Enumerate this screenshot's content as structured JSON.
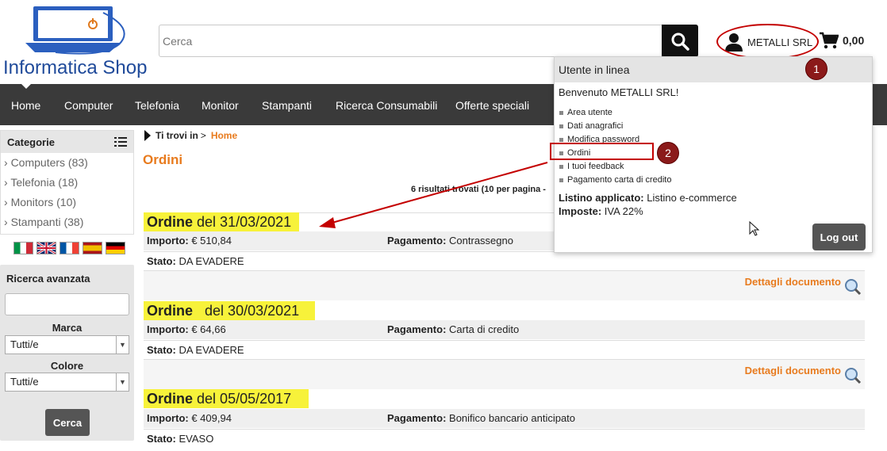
{
  "header": {
    "brand": "Informatica Shop",
    "search_placeholder": "Cerca",
    "user_name": "METALLI SRL",
    "cart_total": "0,00"
  },
  "nav": {
    "items": [
      "Home",
      "Computer",
      "Telefonia",
      "Monitor",
      "Stampanti",
      "Ricerca Consumabili",
      "Offerte speciali"
    ]
  },
  "sidebar": {
    "categories_title": "Categorie",
    "categories": [
      "Computers (83)",
      "Telefonia (18)",
      "Monitors (10)",
      "Stampanti (38)"
    ],
    "advanced_search_title": "Ricerca avanzata",
    "brand_label": "Marca",
    "brand_value": "Tutti/e",
    "color_label": "Colore",
    "color_value": "Tutti/e",
    "search_button": "Cerca"
  },
  "breadcrumb": {
    "prefix": "Ti trovi in",
    "separator": ">",
    "current": "Home"
  },
  "main": {
    "title": "Ordini",
    "results_text": "6 risultati trovati (10 per pagina -",
    "orders": [
      {
        "order_label": "Ordine",
        "date_text": "del 31/03/2021",
        "amount_label": "Importo:",
        "amount": "€ 510,84",
        "payment_label": "Pagamento:",
        "payment": "Contrassegno",
        "status_label": "Stato:",
        "status": "DA EVADERE",
        "details_link": "Dettagli documento"
      },
      {
        "order_label": "Ordine",
        "date_text": "del 30/03/2021",
        "amount_label": "Importo:",
        "amount": "€ 64,66",
        "payment_label": "Pagamento:",
        "payment": "Carta di credito",
        "status_label": "Stato:",
        "status": "DA EVADERE",
        "details_link": "Dettagli documento"
      },
      {
        "order_label": "Ordine",
        "date_text": "del 05/05/2017",
        "amount_label": "Importo:",
        "amount": "€ 409,94",
        "payment_label": "Pagamento:",
        "payment": "Bonifico bancario anticipato",
        "status_label": "Stato:",
        "status": "EVASO",
        "details_link": ""
      }
    ]
  },
  "user_menu": {
    "header": "Utente in linea",
    "welcome": "Benvenuto METALLI SRL!",
    "links": [
      "Area utente",
      "Dati anagrafici",
      "Modifica password",
      "Ordini",
      "I tuoi feedback",
      "Pagamento carta di credito"
    ],
    "price_list_label": "Listino applicato:",
    "price_list_value": "Listino e-commerce",
    "tax_label": "Imposte:",
    "tax_value": "IVA 22%",
    "logout": "Log out"
  },
  "annotations": {
    "step1": "1",
    "step2": "2"
  },
  "colors": {
    "accent": "#e87b1e",
    "nav_bg": "#3a3a3a",
    "highlight": "#f7f23a",
    "annotation_red": "#c40000"
  }
}
